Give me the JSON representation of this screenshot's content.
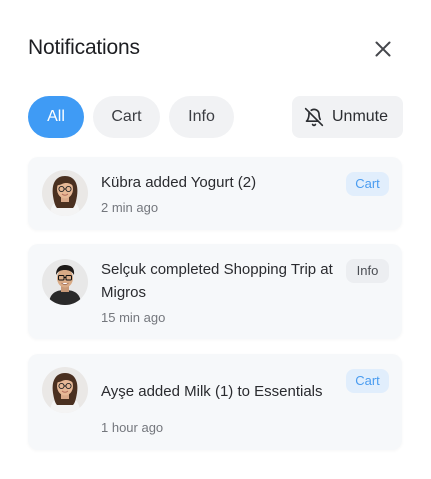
{
  "panel": {
    "title": "Notifications",
    "close_icon": "close-icon"
  },
  "filters": {
    "tabs": [
      {
        "label": "All",
        "active": true
      },
      {
        "label": "Cart",
        "active": false
      },
      {
        "label": "Info",
        "active": false
      }
    ],
    "unmute": {
      "label": "Unmute",
      "icon": "bell-off-icon"
    }
  },
  "notifications": [
    {
      "message": "Kübra added Yogurt (2)",
      "time": "2 min ago",
      "tag": "Cart",
      "avatar": "woman-avatar"
    },
    {
      "message": "Selçuk completed Shopping Trip at Migros",
      "time": "15 min ago",
      "tag": "Info",
      "avatar": "man-avatar"
    },
    {
      "message": "Ayşe added Milk (1) to Essentials",
      "time": "1 hour ago",
      "tag": "Cart",
      "avatar": "woman-avatar"
    }
  ],
  "colors": {
    "accent": "#3f9bf5",
    "chip_bg": "#f1f2f4",
    "card_bg": "#f6f8fa",
    "cart_badge_bg": "#e1eefc",
    "cart_badge_text": "#4a9cf0",
    "info_badge_bg": "#eceef1"
  }
}
